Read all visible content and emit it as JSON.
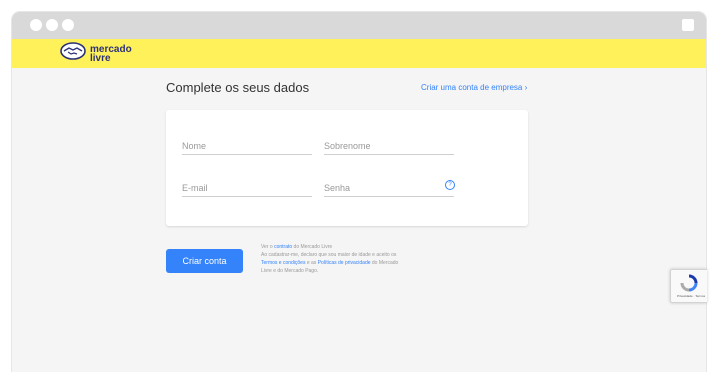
{
  "header": {
    "logo_line1": "mercado",
    "logo_line2": "livre"
  },
  "main": {
    "title": "Complete os seus dados",
    "business_link": "Criar uma conta de empresa ›"
  },
  "form": {
    "nome_placeholder": "Nome",
    "sobrenome_placeholder": "Sobrenome",
    "email_placeholder": "E-mail",
    "senha_placeholder": "Senha",
    "help_icon": "?"
  },
  "actions": {
    "submit_label": "Criar conta"
  },
  "legal": {
    "l1_pre": "Ver o ",
    "l1_link": "contrato",
    "l1_post": " do Mercado Livre",
    "l2": "Ao cadastrar-me, declaro que sou maior de idade e aceito os",
    "l3_link1": "Termos e condições",
    "l3_mid": " e as ",
    "l3_link2": "Políticas de privacidade",
    "l3_post": " do Mercado",
    "l4": "Livre e do Mercado Pago."
  },
  "recaptcha": {
    "text": "Privacidade · Termos"
  },
  "colors": {
    "brand_yellow": "#fff159",
    "accent_blue": "#3483fa",
    "logo_navy": "#2d3277"
  }
}
